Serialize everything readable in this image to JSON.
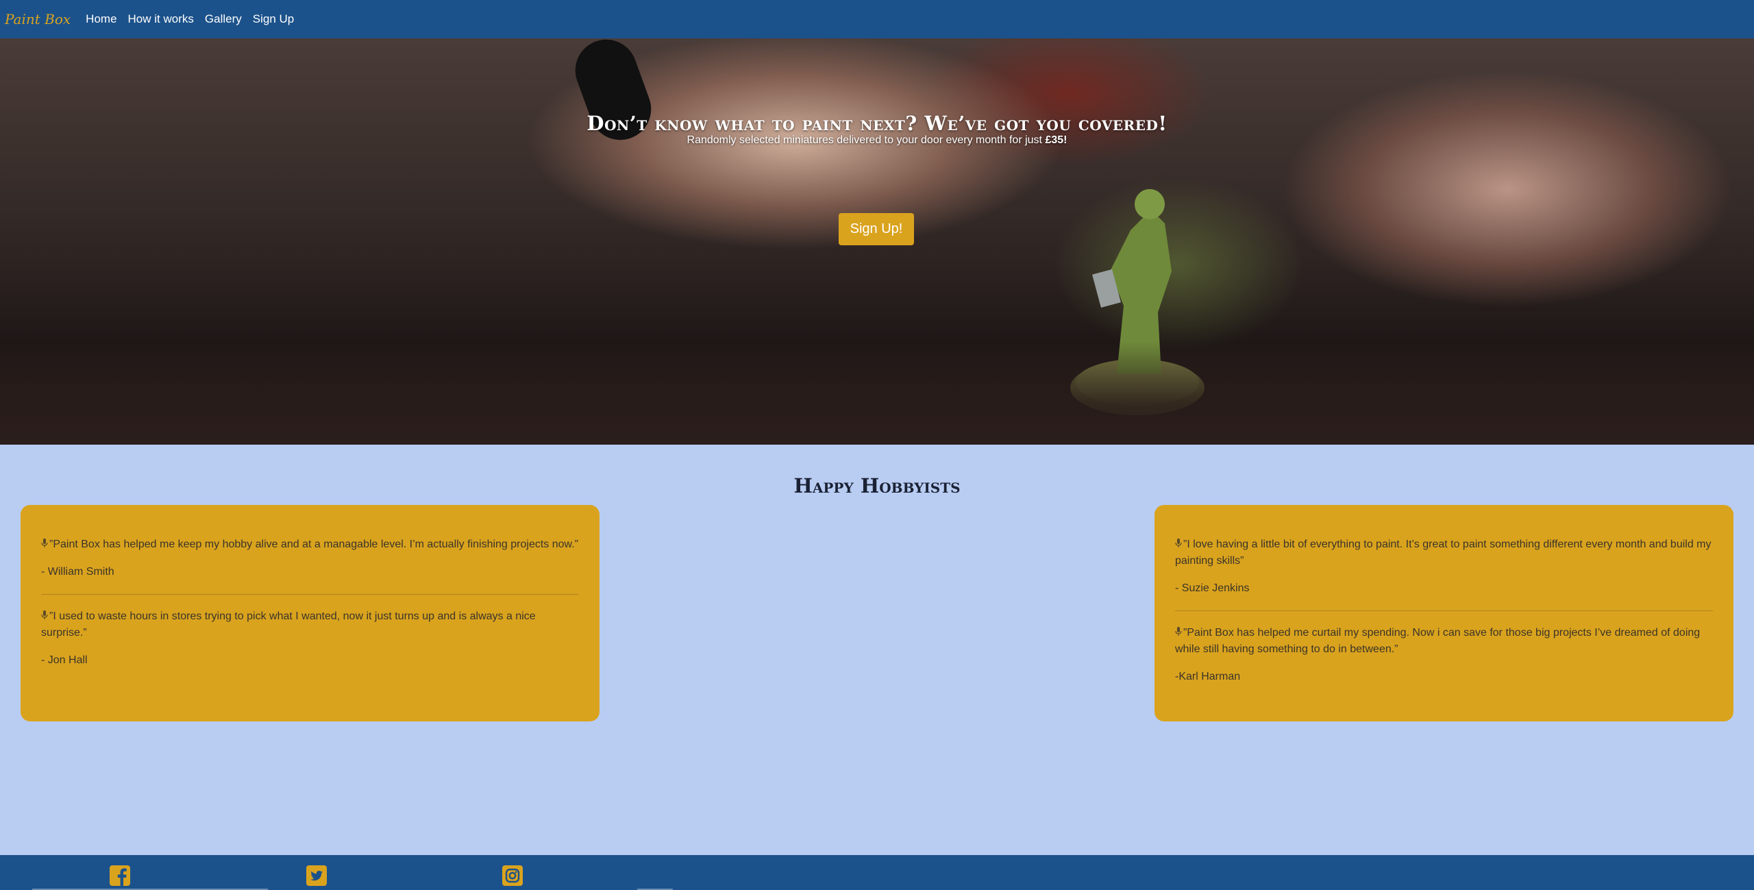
{
  "nav": {
    "brand": "Paint Box",
    "links": [
      "Home",
      "How it works",
      "Gallery",
      "Sign Up"
    ]
  },
  "hero": {
    "title": "Don’t know what to paint next? We’ve got you covered!",
    "subtitle_prefix": "Randomly selected miniatures delivered to your door every month for just ",
    "price": "£35!",
    "button_label": "Sign Up!"
  },
  "testimonials": {
    "title": "Happy Hobbyists",
    "left": [
      {
        "quote": "”Paint Box has helped me keep my hobby alive and at a managable level. I’m actually finishing projects now.”",
        "author": "- William Smith"
      },
      {
        "quote": "”I used to waste hours in stores trying to pick what I wanted, now it just turns up and is always a nice surprise.”",
        "author": "- Jon Hall"
      }
    ],
    "right": [
      {
        "quote": "”I love having a little bit of everything to paint. It’s great to paint something different every month and build my painting skills”",
        "author": "- Suzie Jenkins"
      },
      {
        "quote": "”Paint Box has helped me curtail my spending. Now i can save for those big projects I’ve dreamed of doing while still having something to do in between.”",
        "author": "-Karl Harman"
      }
    ]
  },
  "footer": {
    "icons": [
      "facebook-icon",
      "twitter-icon",
      "instagram-icon"
    ]
  },
  "colors": {
    "nav_bg": "#1c528b",
    "accent": "#daa31e",
    "page_bg": "#b9cdf3"
  }
}
